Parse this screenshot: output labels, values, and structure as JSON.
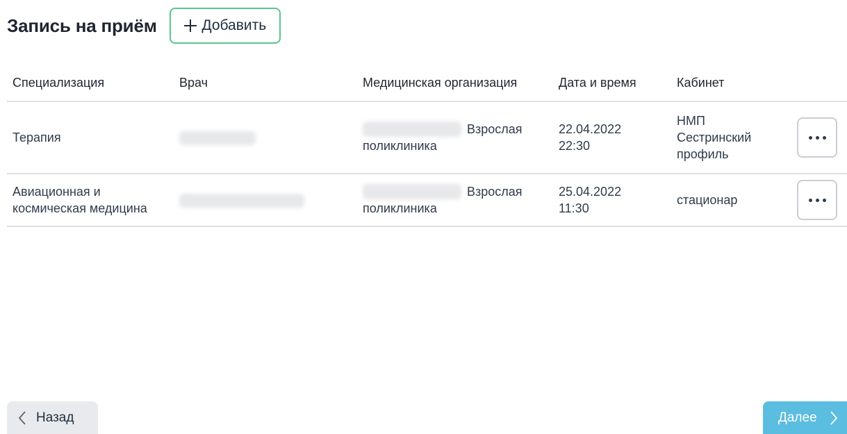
{
  "header": {
    "title": "Запись на приём",
    "add_label": "Добавить"
  },
  "table": {
    "columns": [
      "Специализация",
      "Врач",
      "Медицинская организация",
      "Дата и время",
      "Кабинет"
    ],
    "rows": [
      {
        "specialization": "Терапия",
        "org_suffix": "Взрослая",
        "org_line2": "поликлиника",
        "date": "22.04.2022",
        "time": "22:30",
        "cabinet_lines": [
          "НМП",
          "Сестринский",
          "профиль"
        ]
      },
      {
        "specialization_line1": "Авиационная и",
        "specialization_line2": "космическая медицина",
        "org_suffix": "Взрослая",
        "org_line2": "поликлиника",
        "date": "25.04.2022",
        "time": "11:30",
        "cabinet": "стационар"
      }
    ]
  },
  "footer": {
    "back_label": "Назад",
    "next_label": "Далее"
  },
  "colors": {
    "add_border": "#58c68c",
    "next_bg": "#3fb2db",
    "back_bg": "#e8eaed",
    "divider": "#dde1e6"
  },
  "icons": {
    "add": "plus-icon",
    "more": "more-horizontal-icon",
    "back": "chevron-left-icon",
    "next": "chevron-right-icon"
  }
}
